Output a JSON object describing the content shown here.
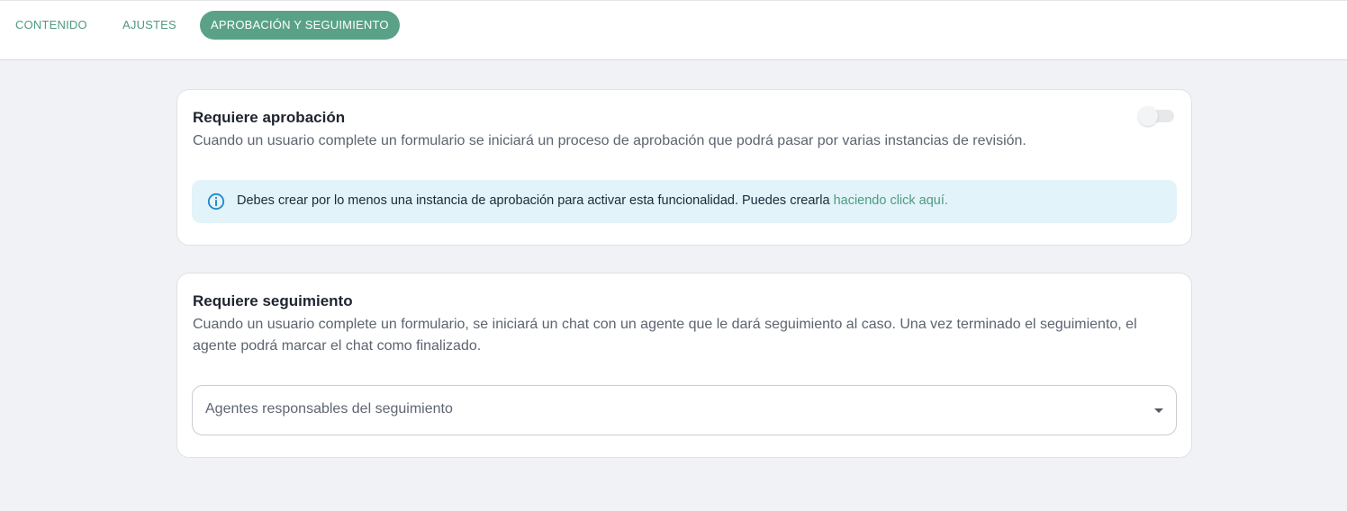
{
  "tabs": [
    {
      "label": "CONTENIDO",
      "active": false
    },
    {
      "label": "AJUSTES",
      "active": false
    },
    {
      "label": "APROBACIÓN Y SEGUIMIENTO",
      "active": true
    }
  ],
  "approval": {
    "title": "Requiere aprobación",
    "description": "Cuando un usuario complete un formulario se iniciará un proceso de aprobación que podrá pasar por varias instancias de revisión.",
    "toggle_on": false,
    "alert": {
      "icon": "info-icon",
      "text": "Debes crear por lo menos una instancia de aprobación para activar esta funcionalidad. Puedes crearla ",
      "link": "haciendo click aquí."
    }
  },
  "followup": {
    "title": "Requiere seguimiento",
    "description": "Cuando un usuario complete un formulario, se iniciará un chat con un agente que le dará seguimiento al caso. Una vez terminado el seguimiento, el agente podrá marcar el chat como finalizado.",
    "select_placeholder": "Agentes responsables del seguimiento"
  },
  "colors": {
    "accent": "#5aa287",
    "accent_text": "#4f9a82",
    "alert_bg": "#e2f3f9",
    "page_bg": "#f1f2f5"
  }
}
